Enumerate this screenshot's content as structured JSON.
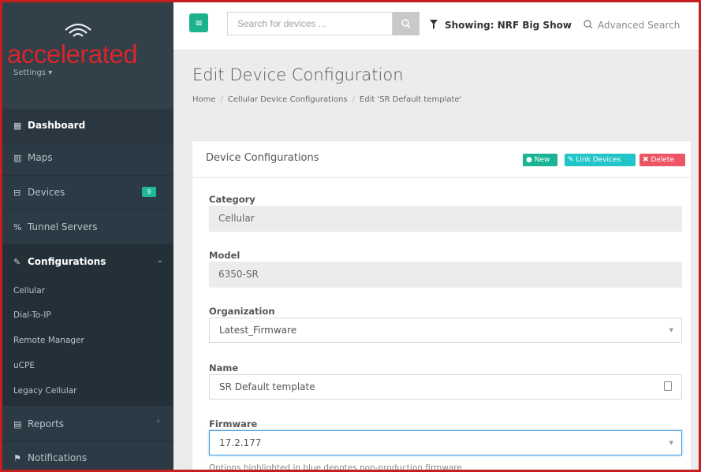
{
  "brand": {
    "name": "accelerated",
    "settings_label": "Settings ▾",
    "logo_icon": "wifi-icon"
  },
  "sidebar": {
    "items": [
      {
        "label": "Dashboard",
        "icon": "grid-icon"
      },
      {
        "label": "Maps",
        "icon": "map-icon"
      },
      {
        "label": "Devices",
        "icon": "devices-icon",
        "badge": "9"
      },
      {
        "label": "Tunnel Servers",
        "icon": "tunnel-icon"
      },
      {
        "label": "Configurations",
        "icon": "wrench-icon"
      },
      {
        "label": "Reports",
        "icon": "file-icon"
      },
      {
        "label": "Notifications",
        "icon": "flag-icon"
      }
    ],
    "config_subitems": [
      "Cellular",
      "Dial-To-IP",
      "Remote Manager",
      "uCPE",
      "Legacy Cellular"
    ]
  },
  "topbar": {
    "search_placeholder": "Search for devices ...",
    "showing": "Showing: NRF Big Show",
    "advanced": "Advanced Search"
  },
  "page": {
    "title": "Edit Device Configuration",
    "breadcrumbs": [
      "Home",
      "Cellular Device Configurations",
      "Edit 'SR Default template'"
    ]
  },
  "card": {
    "title": "Device Configurations",
    "new_label": "New",
    "link_label": "Link Devices",
    "delete_label": "Delete",
    "fields": {
      "category": {
        "label": "Category",
        "value": "Cellular"
      },
      "model": {
        "label": "Model",
        "value": "6350-SR"
      },
      "organization": {
        "label": "Organization",
        "value": "Latest_Firmware"
      },
      "name": {
        "label": "Name",
        "value": "SR Default template"
      },
      "firmware": {
        "label": "Firmware",
        "value": "17.2.177"
      }
    },
    "help": "Options highlighted in blue denotes non-production firmware"
  },
  "colors": {
    "accent": "#1ab394",
    "brand_red": "#d6262b",
    "sidebar_bg": "#2b3a44",
    "danger": "#ed5565",
    "info": "#23c6c8"
  }
}
